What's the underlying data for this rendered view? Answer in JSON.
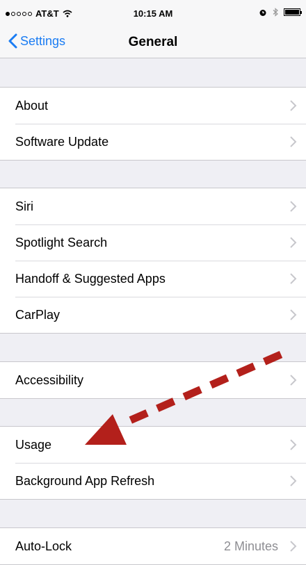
{
  "status_bar": {
    "carrier": "AT&T",
    "time": "10:15 AM",
    "signal_bars_filled": 1,
    "signal_bars_total": 5
  },
  "nav": {
    "back_label": "Settings",
    "title": "General"
  },
  "groups": [
    {
      "rows": [
        {
          "label": "About"
        },
        {
          "label": "Software Update"
        }
      ]
    },
    {
      "rows": [
        {
          "label": "Siri"
        },
        {
          "label": "Spotlight Search"
        },
        {
          "label": "Handoff & Suggested Apps"
        },
        {
          "label": "CarPlay"
        }
      ]
    },
    {
      "rows": [
        {
          "label": "Accessibility"
        }
      ]
    },
    {
      "rows": [
        {
          "label": "Usage"
        },
        {
          "label": "Background App Refresh"
        }
      ]
    },
    {
      "rows": [
        {
          "label": "Auto-Lock",
          "value": "2 Minutes"
        }
      ]
    }
  ],
  "colors": {
    "accent": "#1a7cf3",
    "background": "#efeff4",
    "annotation_arrow": "#b3201b"
  }
}
